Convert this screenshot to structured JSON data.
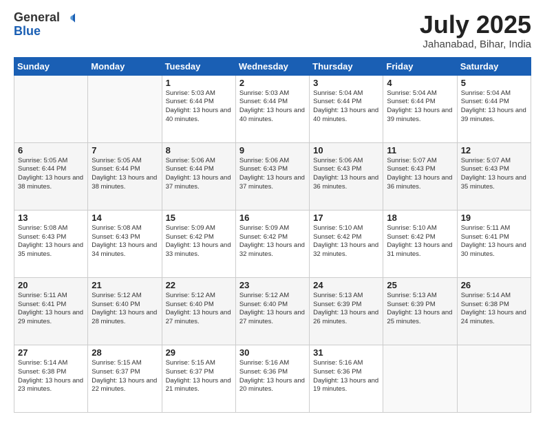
{
  "header": {
    "logo_general": "General",
    "logo_blue": "Blue",
    "month_title": "July 2025",
    "location": "Jahanabad, Bihar, India"
  },
  "days_of_week": [
    "Sunday",
    "Monday",
    "Tuesday",
    "Wednesday",
    "Thursday",
    "Friday",
    "Saturday"
  ],
  "weeks": [
    [
      {
        "day": "",
        "info": ""
      },
      {
        "day": "",
        "info": ""
      },
      {
        "day": "1",
        "info": "Sunrise: 5:03 AM\nSunset: 6:44 PM\nDaylight: 13 hours and 40 minutes."
      },
      {
        "day": "2",
        "info": "Sunrise: 5:03 AM\nSunset: 6:44 PM\nDaylight: 13 hours and 40 minutes."
      },
      {
        "day": "3",
        "info": "Sunrise: 5:04 AM\nSunset: 6:44 PM\nDaylight: 13 hours and 40 minutes."
      },
      {
        "day": "4",
        "info": "Sunrise: 5:04 AM\nSunset: 6:44 PM\nDaylight: 13 hours and 39 minutes."
      },
      {
        "day": "5",
        "info": "Sunrise: 5:04 AM\nSunset: 6:44 PM\nDaylight: 13 hours and 39 minutes."
      }
    ],
    [
      {
        "day": "6",
        "info": "Sunrise: 5:05 AM\nSunset: 6:44 PM\nDaylight: 13 hours and 38 minutes."
      },
      {
        "day": "7",
        "info": "Sunrise: 5:05 AM\nSunset: 6:44 PM\nDaylight: 13 hours and 38 minutes."
      },
      {
        "day": "8",
        "info": "Sunrise: 5:06 AM\nSunset: 6:44 PM\nDaylight: 13 hours and 37 minutes."
      },
      {
        "day": "9",
        "info": "Sunrise: 5:06 AM\nSunset: 6:43 PM\nDaylight: 13 hours and 37 minutes."
      },
      {
        "day": "10",
        "info": "Sunrise: 5:06 AM\nSunset: 6:43 PM\nDaylight: 13 hours and 36 minutes."
      },
      {
        "day": "11",
        "info": "Sunrise: 5:07 AM\nSunset: 6:43 PM\nDaylight: 13 hours and 36 minutes."
      },
      {
        "day": "12",
        "info": "Sunrise: 5:07 AM\nSunset: 6:43 PM\nDaylight: 13 hours and 35 minutes."
      }
    ],
    [
      {
        "day": "13",
        "info": "Sunrise: 5:08 AM\nSunset: 6:43 PM\nDaylight: 13 hours and 35 minutes."
      },
      {
        "day": "14",
        "info": "Sunrise: 5:08 AM\nSunset: 6:43 PM\nDaylight: 13 hours and 34 minutes."
      },
      {
        "day": "15",
        "info": "Sunrise: 5:09 AM\nSunset: 6:42 PM\nDaylight: 13 hours and 33 minutes."
      },
      {
        "day": "16",
        "info": "Sunrise: 5:09 AM\nSunset: 6:42 PM\nDaylight: 13 hours and 32 minutes."
      },
      {
        "day": "17",
        "info": "Sunrise: 5:10 AM\nSunset: 6:42 PM\nDaylight: 13 hours and 32 minutes."
      },
      {
        "day": "18",
        "info": "Sunrise: 5:10 AM\nSunset: 6:42 PM\nDaylight: 13 hours and 31 minutes."
      },
      {
        "day": "19",
        "info": "Sunrise: 5:11 AM\nSunset: 6:41 PM\nDaylight: 13 hours and 30 minutes."
      }
    ],
    [
      {
        "day": "20",
        "info": "Sunrise: 5:11 AM\nSunset: 6:41 PM\nDaylight: 13 hours and 29 minutes."
      },
      {
        "day": "21",
        "info": "Sunrise: 5:12 AM\nSunset: 6:40 PM\nDaylight: 13 hours and 28 minutes."
      },
      {
        "day": "22",
        "info": "Sunrise: 5:12 AM\nSunset: 6:40 PM\nDaylight: 13 hours and 27 minutes."
      },
      {
        "day": "23",
        "info": "Sunrise: 5:12 AM\nSunset: 6:40 PM\nDaylight: 13 hours and 27 minutes."
      },
      {
        "day": "24",
        "info": "Sunrise: 5:13 AM\nSunset: 6:39 PM\nDaylight: 13 hours and 26 minutes."
      },
      {
        "day": "25",
        "info": "Sunrise: 5:13 AM\nSunset: 6:39 PM\nDaylight: 13 hours and 25 minutes."
      },
      {
        "day": "26",
        "info": "Sunrise: 5:14 AM\nSunset: 6:38 PM\nDaylight: 13 hours and 24 minutes."
      }
    ],
    [
      {
        "day": "27",
        "info": "Sunrise: 5:14 AM\nSunset: 6:38 PM\nDaylight: 13 hours and 23 minutes."
      },
      {
        "day": "28",
        "info": "Sunrise: 5:15 AM\nSunset: 6:37 PM\nDaylight: 13 hours and 22 minutes."
      },
      {
        "day": "29",
        "info": "Sunrise: 5:15 AM\nSunset: 6:37 PM\nDaylight: 13 hours and 21 minutes."
      },
      {
        "day": "30",
        "info": "Sunrise: 5:16 AM\nSunset: 6:36 PM\nDaylight: 13 hours and 20 minutes."
      },
      {
        "day": "31",
        "info": "Sunrise: 5:16 AM\nSunset: 6:36 PM\nDaylight: 13 hours and 19 minutes."
      },
      {
        "day": "",
        "info": ""
      },
      {
        "day": "",
        "info": ""
      }
    ]
  ]
}
